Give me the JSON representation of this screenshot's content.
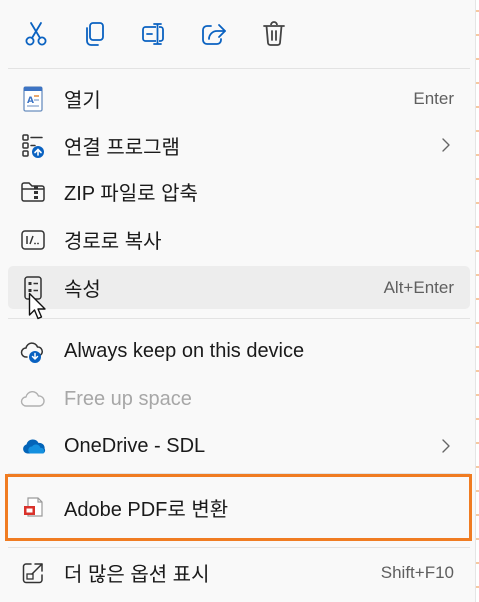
{
  "toolbar": {
    "buttons": [
      {
        "name": "cut",
        "icon": "scissors-icon"
      },
      {
        "name": "copy",
        "icon": "copy-icon"
      },
      {
        "name": "rename",
        "icon": "rename-icon"
      },
      {
        "name": "share",
        "icon": "share-icon"
      },
      {
        "name": "delete",
        "icon": "trash-icon"
      }
    ]
  },
  "menu": {
    "open": {
      "label": "열기",
      "shortcut": "Enter",
      "icon": "document-icon"
    },
    "open_with": {
      "label": "연결 프로그램",
      "icon": "apps-icon"
    },
    "zip": {
      "label": "ZIP 파일로 압축",
      "icon": "zip-folder-icon"
    },
    "copy_path": {
      "label": "경로로 복사",
      "icon": "path-icon"
    },
    "properties": {
      "label": "속성",
      "shortcut": "Alt+Enter",
      "icon": "properties-icon"
    },
    "always_keep": {
      "label": "Always keep on this device",
      "icon": "cloud-download-icon"
    },
    "free_up": {
      "label": "Free up space",
      "icon": "cloud-outline-icon"
    },
    "onedrive": {
      "label": "OneDrive - SDL",
      "icon": "onedrive-icon"
    },
    "adobe_pdf": {
      "label": "Adobe PDF로 변환",
      "icon": "pdf-icon"
    },
    "more_options": {
      "label": "더 많은 옵션 표시",
      "shortcut": "Shift+F10",
      "icon": "external-icon"
    }
  },
  "colors": {
    "accent": "#0a62c1",
    "highlight_border": "#f07c22",
    "hover_bg": "#ededed",
    "menu_bg": "#f9f9f9"
  }
}
